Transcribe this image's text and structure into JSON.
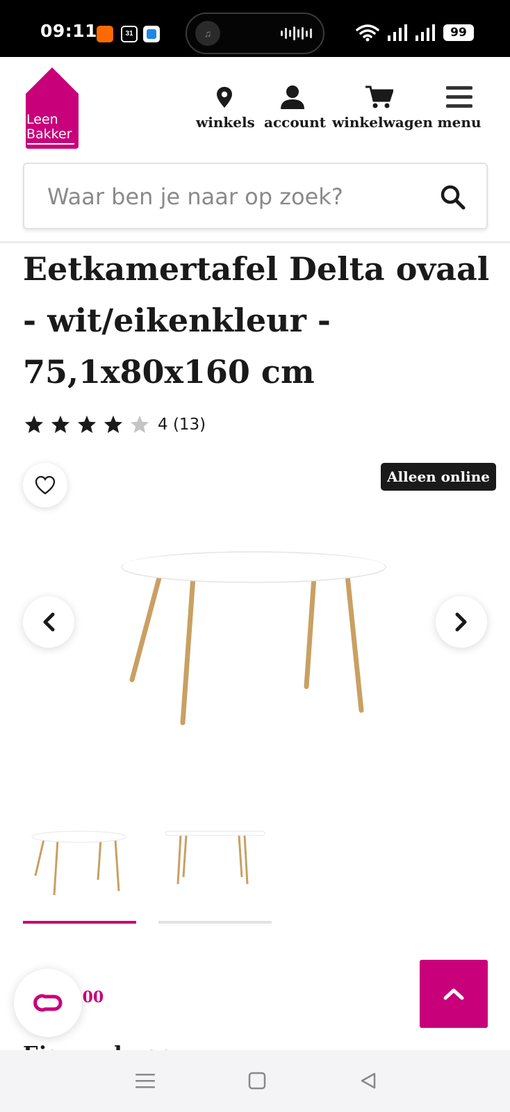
{
  "status_bar": {
    "time": "09:11",
    "calendar_badge": "31",
    "battery": "99",
    "icons": [
      "alibaba-app-icon",
      "calendar-icon",
      "blue-app-icon",
      "music-icon",
      "wifi-icon",
      "signal-icon",
      "battery-icon"
    ]
  },
  "header": {
    "logo": {
      "line1": "Leen",
      "line2": "Bakker"
    },
    "nav": [
      {
        "label": "winkels",
        "icon": "location-pin-icon"
      },
      {
        "label": "account",
        "icon": "user-icon"
      },
      {
        "label": "winkelwagen",
        "icon": "cart-icon"
      },
      {
        "label": "menu",
        "icon": "hamburger-icon"
      }
    ]
  },
  "search": {
    "placeholder": "Waar ben je naar op zoek?",
    "value": ""
  },
  "product": {
    "title": "Eetkamertafel Delta ovaal - wit/eikenkleur - 75,1x80x160 cm",
    "rating_value": 4,
    "rating_max": 5,
    "rating_text": "4 (13)",
    "badge": "Alleen online",
    "price_visible": ",",
    "price_cents": "00",
    "next_heading": "Eigenschappen",
    "gallery": {
      "image_count": 2,
      "active_index": 0
    }
  },
  "colors": {
    "brand": "#c8007a",
    "text": "#1a1a1a",
    "badge_bg": "#1a1a1a",
    "table_top": "#ffffff",
    "table_legs": "#c9a063"
  }
}
